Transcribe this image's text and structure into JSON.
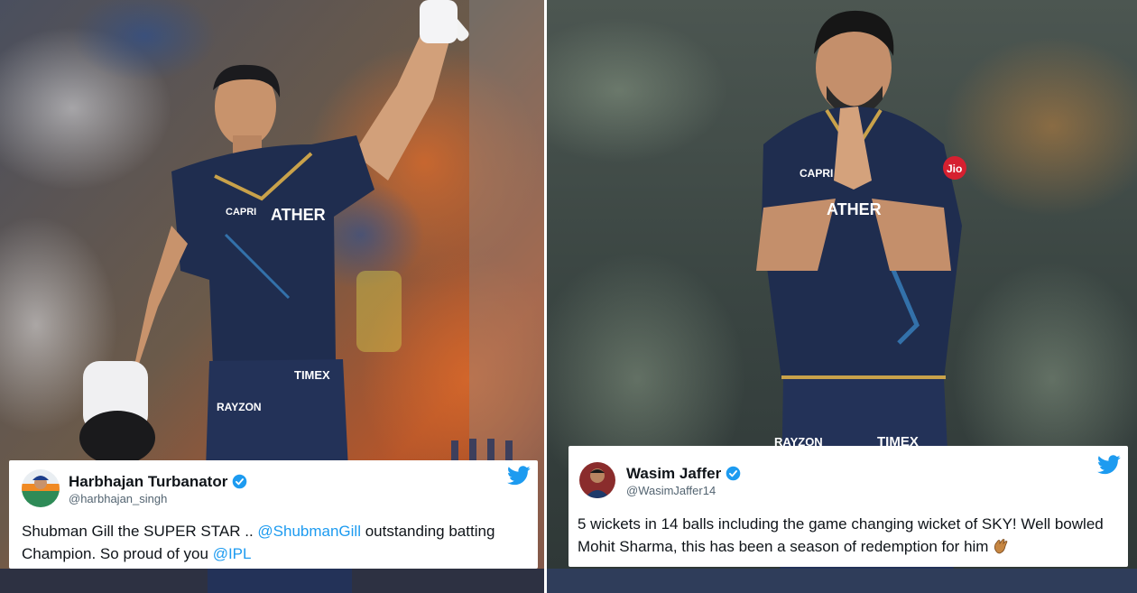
{
  "left_tweet": {
    "display_name": "Harbhajan Turbanator",
    "handle": "@harbhajan_singh",
    "text_before": "Shubman Gill the SUPER STAR .. ",
    "mention_1": "@ShubmanGill",
    "text_middle": " outstanding batting Champion. So proud of you ",
    "mention_2": "@IPL"
  },
  "right_tweet": {
    "display_name": "Wasim Jaffer",
    "handle": "@WasimJaffer14",
    "text": "5 wickets in 14 balls including the game changing wicket of SKY! Well bowled Mohit Sharma, this has been a season of redemption for him"
  },
  "jersey": {
    "left_sponsor": "ATHER",
    "left_chest": "CAPRI",
    "left_sleeve": "RAYZON",
    "left_shorts": "TIMEX",
    "right_sponsor": "ATHER",
    "right_chest": "CAPRI",
    "right_belt_left": "RAYZON",
    "right_belt_right": "TIMEX",
    "right_sleeve": "Jio"
  },
  "colors": {
    "twitter_blue": "#1d9bf0",
    "jersey_navy": "#1f2d4f",
    "jersey_gold": "#c9a24a"
  },
  "icons": [
    "twitter-bird-icon",
    "verified-badge-icon",
    "clapping-hands-icon"
  ]
}
